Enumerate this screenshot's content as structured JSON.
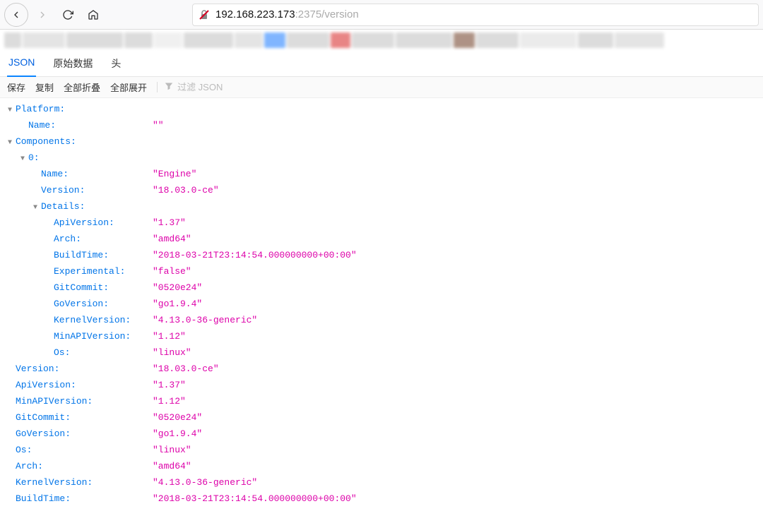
{
  "toolbar": {
    "url_host": "192.168.223.173",
    "url_port_path": ":2375/version"
  },
  "tabs": {
    "json": "JSON",
    "raw": "原始数据",
    "headers": "头"
  },
  "actions": {
    "save": "保存",
    "copy": "复制",
    "collapse_all": "全部折叠",
    "expand_all": "全部展开",
    "filter_placeholder": "过滤 JSON"
  },
  "tree": [
    {
      "indent": 0,
      "collapser": "▼",
      "key": "Platform:",
      "val": null
    },
    {
      "indent": 1,
      "collapser": "",
      "key": "Name:",
      "val": "\"\""
    },
    {
      "indent": 0,
      "collapser": "▼",
      "key": "Components:",
      "val": null
    },
    {
      "indent": 1,
      "collapser": "▼",
      "key": "0:",
      "val": null
    },
    {
      "indent": 2,
      "collapser": "",
      "key": "Name:",
      "val": "\"Engine\""
    },
    {
      "indent": 2,
      "collapser": "",
      "key": "Version:",
      "val": "\"18.03.0-ce\""
    },
    {
      "indent": 2,
      "collapser": "▼",
      "key": "Details:",
      "val": null
    },
    {
      "indent": 3,
      "collapser": "",
      "key": "ApiVersion:",
      "val": "\"1.37\""
    },
    {
      "indent": 3,
      "collapser": "",
      "key": "Arch:",
      "val": "\"amd64\""
    },
    {
      "indent": 3,
      "collapser": "",
      "key": "BuildTime:",
      "val": "\"2018-03-21T23:14:54.000000000+00:00\""
    },
    {
      "indent": 3,
      "collapser": "",
      "key": "Experimental:",
      "val": "\"false\""
    },
    {
      "indent": 3,
      "collapser": "",
      "key": "GitCommit:",
      "val": "\"0520e24\""
    },
    {
      "indent": 3,
      "collapser": "",
      "key": "GoVersion:",
      "val": "\"go1.9.4\""
    },
    {
      "indent": 3,
      "collapser": "",
      "key": "KernelVersion:",
      "val": "\"4.13.0-36-generic\""
    },
    {
      "indent": 3,
      "collapser": "",
      "key": "MinAPIVersion:",
      "val": "\"1.12\""
    },
    {
      "indent": 3,
      "collapser": "",
      "key": "Os:",
      "val": "\"linux\""
    },
    {
      "indent": 0,
      "collapser": "",
      "key": "Version:",
      "val": "\"18.03.0-ce\""
    },
    {
      "indent": 0,
      "collapser": "",
      "key": "ApiVersion:",
      "val": "\"1.37\""
    },
    {
      "indent": 0,
      "collapser": "",
      "key": "MinAPIVersion:",
      "val": "\"1.12\""
    },
    {
      "indent": 0,
      "collapser": "",
      "key": "GitCommit:",
      "val": "\"0520e24\""
    },
    {
      "indent": 0,
      "collapser": "",
      "key": "GoVersion:",
      "val": "\"go1.9.4\""
    },
    {
      "indent": 0,
      "collapser": "",
      "key": "Os:",
      "val": "\"linux\""
    },
    {
      "indent": 0,
      "collapser": "",
      "key": "Arch:",
      "val": "\"amd64\""
    },
    {
      "indent": 0,
      "collapser": "",
      "key": "KernelVersion:",
      "val": "\"4.13.0-36-generic\""
    },
    {
      "indent": 0,
      "collapser": "",
      "key": "BuildTime:",
      "val": "\"2018-03-21T23:14:54.000000000+00:00\""
    }
  ]
}
